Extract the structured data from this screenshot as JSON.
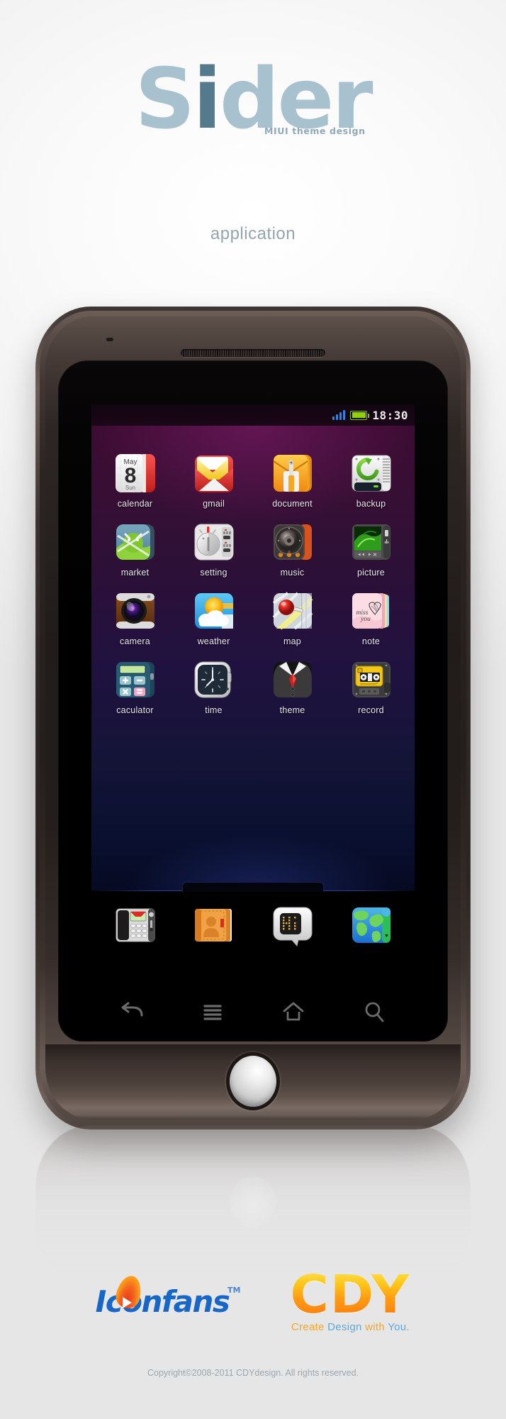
{
  "header": {
    "title_light": "S",
    "title_dark": "i",
    "title_rest": "der",
    "tagline": "MIUI theme design",
    "subtitle": "application",
    "accent_color": "#a8c1ce",
    "accent_dark": "#55798d"
  },
  "phone": {
    "statusbar": {
      "time": "18:30",
      "signal_bars": 4,
      "signal_color": "#2b86e0",
      "battery_color": "#8fd400",
      "battery_level": "full"
    },
    "wallpaper": {
      "top_color": "#3d0c33",
      "bottom_color": "#060a22"
    },
    "grid": [
      [
        {
          "label": "calendar",
          "icon": "calendar-icon",
          "month": "May",
          "day": "8",
          "weekday": "Sun"
        },
        {
          "label": "gmail",
          "icon": "gmail-icon"
        },
        {
          "label": "document",
          "icon": "document-icon"
        },
        {
          "label": "backup",
          "icon": "backup-icon"
        }
      ],
      [
        {
          "label": "market",
          "icon": "market-icon"
        },
        {
          "label": "setting",
          "icon": "setting-icon"
        },
        {
          "label": "music",
          "icon": "music-icon"
        },
        {
          "label": "picture",
          "icon": "picture-icon"
        }
      ],
      [
        {
          "label": "camera",
          "icon": "camera-icon"
        },
        {
          "label": "weather",
          "icon": "weather-icon"
        },
        {
          "label": "map",
          "icon": "map-icon"
        },
        {
          "label": "note",
          "icon": "note-icon",
          "note_line1": "miss",
          "note_line2": "you"
        }
      ],
      [
        {
          "label": "caculator",
          "icon": "calculator-icon"
        },
        {
          "label": "time",
          "icon": "clock-icon"
        },
        {
          "label": "theme",
          "icon": "theme-icon"
        },
        {
          "label": "record",
          "icon": "recorder-icon"
        }
      ]
    ],
    "dock": [
      {
        "label": "phone",
        "icon": "phone-icon"
      },
      {
        "label": "contacts",
        "icon": "contacts-icon"
      },
      {
        "label": "messaging",
        "icon": "messaging-icon",
        "screen_text": "Hi"
      },
      {
        "label": "browser",
        "icon": "globe-icon"
      }
    ],
    "navbar": [
      {
        "label": "back",
        "icon": "back-arrow-icon"
      },
      {
        "label": "menu",
        "icon": "menu-icon"
      },
      {
        "label": "home",
        "icon": "home-icon"
      },
      {
        "label": "search",
        "icon": "search-icon"
      }
    ]
  },
  "footer": {
    "iconfans": "Iconfans",
    "iconfans_tm": "TM",
    "cdy": "CDY",
    "cdy_tag_1": "Create ",
    "cdy_tag_2": "Design ",
    "cdy_tag_3": "with ",
    "cdy_tag_4": "You.",
    "copyright": "Copyright©2008-2011 CDYdesign. All rights reserved."
  }
}
